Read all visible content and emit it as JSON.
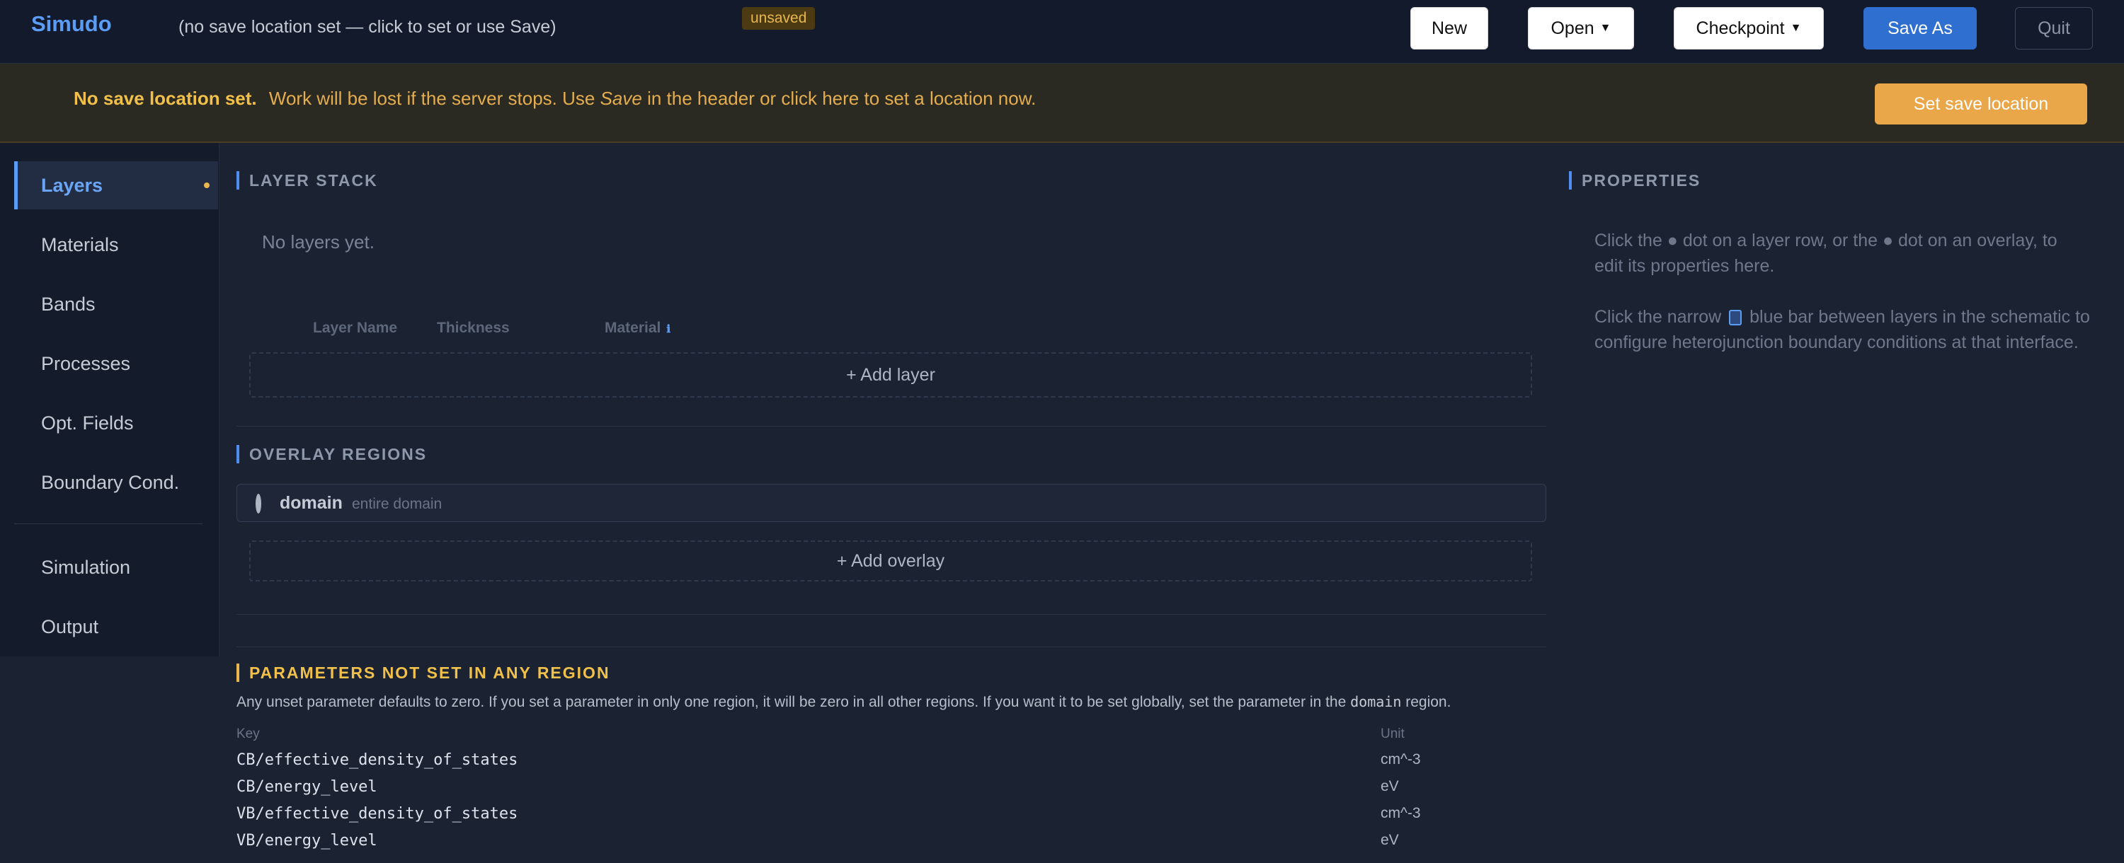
{
  "header": {
    "brand": "Simudo",
    "save_location": "(no save location set — click to set or use Save)",
    "status_badge": "unsaved",
    "buttons": {
      "new": "New",
      "open": "Open",
      "checkpoint": "Checkpoint",
      "save_as": "Save As",
      "quit": "Quit"
    }
  },
  "banner": {
    "bold": "No save location set.",
    "pre": "Work will be lost if the server stops. Use",
    "em": "Save",
    "post": "in the header or click here to set a location now.",
    "button": "Set save location"
  },
  "sidebar": {
    "items": [
      {
        "label": "Layers",
        "active": true
      },
      {
        "label": "Materials"
      },
      {
        "label": "Bands"
      },
      {
        "label": "Processes"
      },
      {
        "label": "Opt. Fields"
      },
      {
        "label": "Boundary Cond."
      },
      {
        "label": "Simulation"
      },
      {
        "label": "Output"
      }
    ]
  },
  "layer_stack": {
    "title": "LAYER STACK",
    "empty": "No layers yet.",
    "columns": [
      "Layer Name",
      "Thickness",
      "Material"
    ],
    "add_button": "+ Add layer"
  },
  "overlays": {
    "title": "OVERLAY REGIONS",
    "items": [
      {
        "name": "domain",
        "description": "entire domain"
      }
    ],
    "add_button": "+ Add overlay"
  },
  "unset_params": {
    "title": "PARAMETERS NOT SET IN ANY REGION",
    "note_pre": "Any unset parameter defaults to zero. If you set a parameter in only one region, it will be zero in all other regions. If you want it to be set globally, set the parameter in the",
    "note_code": "domain",
    "note_post": "region.",
    "col_key": "Key",
    "col_unit": "Unit",
    "rows": [
      {
        "key": "CB/effective_density_of_states",
        "unit": "cm^-3"
      },
      {
        "key": "CB/energy_level",
        "unit": "eV"
      },
      {
        "key": "VB/effective_density_of_states",
        "unit": "cm^-3"
      },
      {
        "key": "VB/energy_level",
        "unit": "eV"
      }
    ]
  },
  "properties": {
    "title": "PROPERTIES",
    "p1": "Click the ● dot on a layer row, or the ● dot on an overlay, to edit its properties here.",
    "p2_pre": "Click the narrow",
    "p2_post": "blue bar between layers in the schematic to configure heterojunction boundary conditions at that interface."
  },
  "colors": {
    "accent": "#5b9df5",
    "warning": "#e8b64c",
    "save_as_button": "#2f6fd0",
    "background": "#1b2232"
  }
}
